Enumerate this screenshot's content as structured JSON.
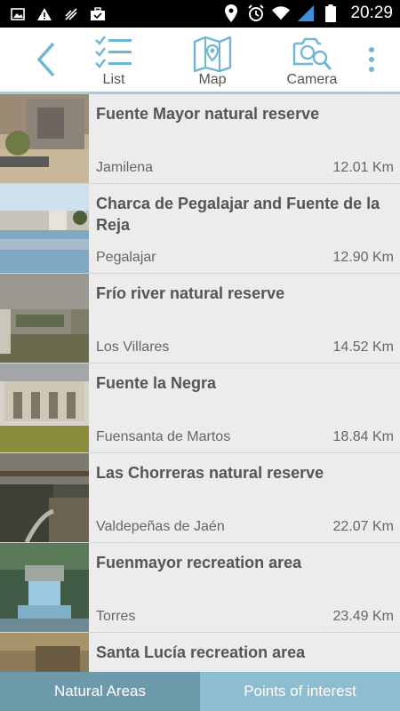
{
  "statusbar": {
    "time": "20:29"
  },
  "toolbar": {
    "list_label": "List",
    "map_label": "Map",
    "camera_label": "Camera"
  },
  "places": [
    {
      "title": "Fuente Mayor natural reserve",
      "town": "Jamilena",
      "distance": "12.01 Km"
    },
    {
      "title": "Charca de Pegalajar and Fuente de la Reja",
      "town": "Pegalajar",
      "distance": "12.90 Km"
    },
    {
      "title": "Frío river natural reserve",
      "town": "Los Villares",
      "distance": "14.52 Km"
    },
    {
      "title": "Fuente la Negra",
      "town": "Fuensanta de Martos",
      "distance": "18.84 Km"
    },
    {
      "title": "Las Chorreras natural reserve",
      "town": "Valdepeñas de Jaén",
      "distance": "22.07 Km"
    },
    {
      "title": "Fuenmayor recreation area",
      "town": "Torres",
      "distance": "23.49 Km"
    },
    {
      "title": "Santa Lucía recreation area",
      "town": "",
      "distance": ""
    }
  ],
  "tabs": {
    "natural_areas": "Natural Areas",
    "points_of_interest": "Points of interest"
  },
  "colors": {
    "accent": "#6fb6d4",
    "tab_active": "#6d9aaa",
    "tab_inactive": "#8dbdd0"
  }
}
